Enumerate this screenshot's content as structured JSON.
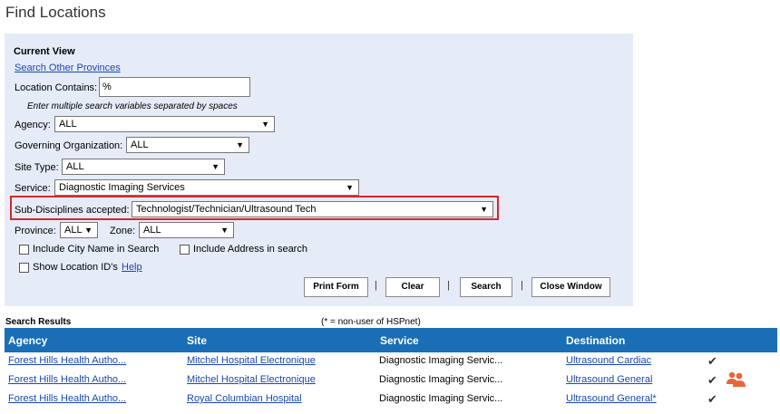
{
  "page": {
    "title": "Find Locations"
  },
  "form": {
    "section_title": "Current View",
    "search_other_provinces": "Search Other Provinces",
    "location_contains_label": "Location Contains:",
    "location_contains_value": "%",
    "hint": "Enter multiple search variables separated by spaces",
    "agency": {
      "label": "Agency:",
      "value": "ALL"
    },
    "governing_org": {
      "label": "Governing Organization:",
      "value": "ALL"
    },
    "site_type": {
      "label": "Site Type:",
      "value": "ALL"
    },
    "service": {
      "label": "Service:",
      "value": "Diagnostic Imaging Services"
    },
    "sub_disciplines": {
      "label": "Sub-Disciplines accepted:",
      "value": "Technologist/Technician/Ultrasound Tech"
    },
    "province": {
      "label": "Province:",
      "value": "ALL"
    },
    "zone": {
      "label": "Zone:",
      "value": "ALL"
    },
    "include_city": "Include City Name in Search",
    "include_address": "Include Address in search",
    "show_location_ids": "Show Location ID's",
    "help": "Help",
    "buttons": {
      "print": "Print Form",
      "clear": "Clear",
      "search": "Search",
      "close": "Close Window"
    },
    "pipe": "|"
  },
  "results": {
    "title": "Search Results",
    "note": "(* = non-user of HSPnet)",
    "columns": [
      "Agency",
      "Site",
      "Service",
      "Destination"
    ],
    "rows": [
      {
        "agency": "Forest Hills Health Autho...",
        "site": "Mitchel Hospital Electronique",
        "service": "Diagnostic Imaging Servic...",
        "destination": "Ultrasound Cardiac"
      },
      {
        "agency": "Forest Hills Health Autho...",
        "site": "Mitchel Hospital Electronique",
        "service": "Diagnostic Imaging Servic...",
        "destination": "Ultrasound General"
      },
      {
        "agency": "Forest Hills Health Autho...",
        "site": "Royal Columbian Hospital",
        "service": "Diagnostic Imaging Servic...",
        "destination": "Ultrasound General*"
      }
    ],
    "check_glyph": "✔"
  },
  "icons": {
    "dropdown": "triangle-down",
    "check": "checkmark-icon",
    "people": "people-group-icon"
  },
  "colors": {
    "panel": "#e6ebf8",
    "header": "#1a6eb6",
    "link": "#1a47b0",
    "highlight": "#d6262f",
    "people_icon": "#e8653a"
  }
}
